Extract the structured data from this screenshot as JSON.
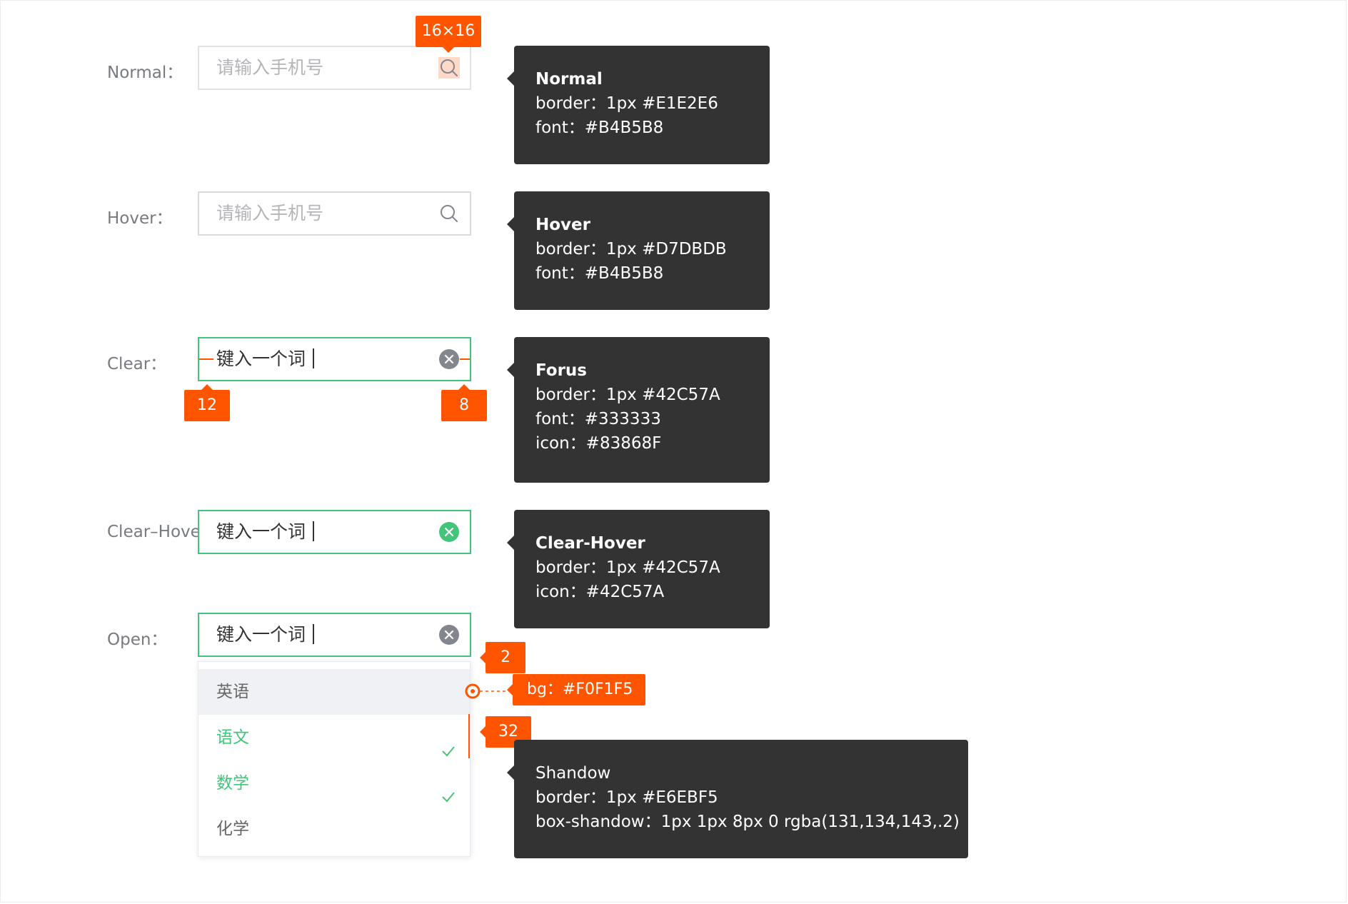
{
  "colors": {
    "normal_border": "#E1E2E6",
    "hover_border": "#D7DBDB",
    "focus_border": "#42C57A",
    "placeholder": "#B4B5B8",
    "text": "#333333",
    "icon": "#83868F",
    "icon_hover": "#42C57A",
    "option_hover_bg": "#F0F1F5",
    "annotation": "#FF5500",
    "tooltip_bg": "#333333"
  },
  "rows": {
    "normal": {
      "label": "Normal：",
      "placeholder": "请输入手机号"
    },
    "hover": {
      "label": "Hover：",
      "placeholder": "请输入手机号"
    },
    "clear": {
      "label": "Clear：",
      "value": "键入一个词"
    },
    "clear_hover": {
      "label": "Clear–Hover",
      "value": "键入一个词"
    },
    "open": {
      "label": "Open：",
      "value": "键入一个词"
    }
  },
  "dropdown": {
    "options": [
      {
        "label": "英语",
        "state": "hover"
      },
      {
        "label": "语文",
        "state": "selected"
      },
      {
        "label": "数学",
        "state": "selected"
      },
      {
        "label": "化学",
        "state": "normal"
      }
    ]
  },
  "tooltips": {
    "normal": {
      "title": "Normal",
      "lines": [
        "border：1px #E1E2E6",
        "font：#B4B5B8"
      ]
    },
    "hover": {
      "title": "Hover",
      "lines": [
        "border：1px #D7DBDB",
        "font：#B4B5B8"
      ]
    },
    "focus": {
      "title": "Forus",
      "lines": [
        "border：1px #42C57A",
        "font：#333333",
        "icon：#83868F"
      ]
    },
    "clear_hover": {
      "title": "Clear-Hover",
      "lines": [
        "border：1px #42C57A",
        "icon：#42C57A"
      ]
    },
    "shadow": {
      "title": "Shandow",
      "lines": [
        "border：1px #E6EBF5",
        "box-shandow：1px 1px 8px 0 rgba(131,134,143,.2)"
      ]
    }
  },
  "annotations": {
    "icon_size": "16×16",
    "padding_left": "12",
    "padding_right": "8",
    "dropdown_gap": "2",
    "option_bg": "bg：#F0F1F5",
    "option_height": "32"
  },
  "icons": {
    "search": "search-icon",
    "clear": "clear-icon",
    "check": "check-icon"
  }
}
